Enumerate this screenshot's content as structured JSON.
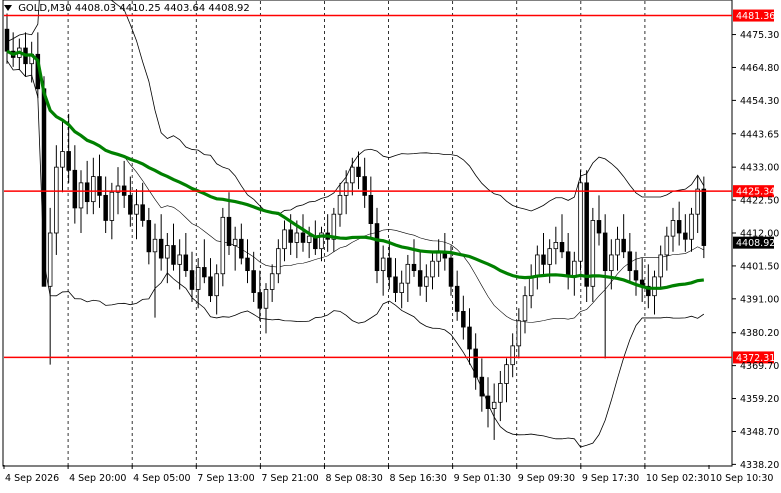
{
  "symbol_info": {
    "symbol": "GOLD,M30",
    "ohlc": "4408.03 4410.25 4403.64 4408.92"
  },
  "colors": {
    "level_line": "#ff0000",
    "ma_line": "#008000",
    "bollinger": "#000000",
    "candle": "#000000",
    "price_tag_text": "#ffffff",
    "current_price_tag": "#000000"
  },
  "chart_data": {
    "type": "candlestick",
    "y_range": [
      4338.0,
      4486.0
    ],
    "y_ticks": [
      "4475.30",
      "4464.80",
      "4454.30",
      "4443.65",
      "4433.00",
      "4422.50",
      "4412.00",
      "4401.50",
      "4391.00",
      "4380.20",
      "4369.70",
      "4359.20",
      "4348.70",
      "4338.20"
    ],
    "x_ticks": [
      "4 Sep 2026",
      "4 Sep 20:00",
      "4 Sep 05:00",
      "7 Sep 13:00",
      "7 Sep 21:00",
      "8 Sep 08:30",
      "8 Sep 16:30",
      "9 Sep 01:30",
      "9 Sep 09:30",
      "9 Sep 17:30",
      "10 Sep 02:30",
      "10 Sep 10:30"
    ],
    "grid": "vertical dashed separators",
    "levels": [
      {
        "label": "4481.36",
        "value": 4481.36
      },
      {
        "label": "4425.34",
        "value": 4425.34
      },
      {
        "label": "4372.31",
        "value": 4372.31
      }
    ],
    "current_price": {
      "label": "4408.92",
      "value": 4408.92
    },
    "ohlc_approx": [
      [
        4477,
        4482,
        4466,
        4470
      ],
      [
        4470,
        4476,
        4465,
        4468
      ],
      [
        4468,
        4474,
        4464,
        4471
      ],
      [
        4471,
        4476,
        4462,
        4466
      ],
      [
        4466,
        4473,
        4460,
        4469
      ],
      [
        4469,
        4476,
        4455,
        4458
      ],
      [
        4458,
        4462,
        4400,
        4395
      ],
      [
        4395,
        4420,
        4370,
        4412
      ],
      [
        4412,
        4440,
        4405,
        4433
      ],
      [
        4433,
        4448,
        4425,
        4438
      ],
      [
        4438,
        4450,
        4428,
        4432
      ],
      [
        4432,
        4440,
        4415,
        4420
      ],
      [
        4420,
        4432,
        4412,
        4428
      ],
      [
        4428,
        4435,
        4418,
        4422
      ],
      [
        4422,
        4436,
        4418,
        4430
      ],
      [
        4430,
        4437,
        4420,
        4424
      ],
      [
        4424,
        4430,
        4412,
        4416
      ],
      [
        4416,
        4428,
        4410,
        4425
      ],
      [
        4425,
        4433,
        4418,
        4427
      ],
      [
        4427,
        4435,
        4420,
        4424
      ],
      [
        4424,
        4430,
        4414,
        4418
      ],
      [
        4418,
        4426,
        4410,
        4421
      ],
      [
        4421,
        4428,
        4414,
        4416
      ],
      [
        4416,
        4420,
        4402,
        4406
      ],
      [
        4406,
        4415,
        4385,
        4410
      ],
      [
        4410,
        4418,
        4400,
        4404
      ],
      [
        4404,
        4412,
        4396,
        4408
      ],
      [
        4408,
        4415,
        4400,
        4402
      ],
      [
        4402,
        4410,
        4394,
        4405
      ],
      [
        4405,
        4412,
        4398,
        4400
      ],
      [
        4400,
        4406,
        4390,
        4394
      ],
      [
        4394,
        4404,
        4388,
        4401
      ],
      [
        4401,
        4410,
        4396,
        4398
      ],
      [
        4398,
        4404,
        4390,
        4392
      ],
      [
        4392,
        4402,
        4386,
        4399
      ],
      [
        4399,
        4420,
        4395,
        4417
      ],
      [
        4417,
        4425,
        4405,
        4408
      ],
      [
        4408,
        4414,
        4400,
        4410
      ],
      [
        4410,
        4415,
        4402,
        4404
      ],
      [
        4404,
        4410,
        4396,
        4400
      ],
      [
        4400,
        4406,
        4390,
        4393
      ],
      [
        4393,
        4400,
        4384,
        4388
      ],
      [
        4388,
        4396,
        4380,
        4394
      ],
      [
        4394,
        4402,
        4390,
        4399
      ],
      [
        4399,
        4410,
        4396,
        4407
      ],
      [
        4407,
        4416,
        4403,
        4413
      ],
      [
        4413,
        4418,
        4405,
        4409
      ],
      [
        4409,
        4416,
        4404,
        4412
      ],
      [
        4412,
        4418,
        4406,
        4409
      ],
      [
        4409,
        4414,
        4404,
        4411
      ],
      [
        4411,
        4416,
        4405,
        4407
      ],
      [
        4407,
        4414,
        4403,
        4412
      ],
      [
        4412,
        4418,
        4406,
        4410
      ],
      [
        4410,
        4420,
        4406,
        4418
      ],
      [
        4418,
        4428,
        4414,
        4424
      ],
      [
        4424,
        4432,
        4418,
        4428
      ],
      [
        4428,
        4436,
        4424,
        4433
      ],
      [
        4433,
        4438,
        4426,
        4430
      ],
      [
        4430,
        4436,
        4420,
        4424
      ],
      [
        4424,
        4430,
        4410,
        4415
      ],
      [
        4415,
        4420,
        4396,
        4400
      ],
      [
        4400,
        4408,
        4392,
        4404
      ],
      [
        4404,
        4410,
        4394,
        4398
      ],
      [
        4398,
        4404,
        4390,
        4393
      ],
      [
        4393,
        4400,
        4388,
        4396
      ],
      [
        4396,
        4405,
        4390,
        4402
      ],
      [
        4402,
        4410,
        4398,
        4400
      ],
      [
        4400,
        4406,
        4392,
        4395
      ],
      [
        4395,
        4402,
        4390,
        4398
      ],
      [
        4398,
        4406,
        4394,
        4403
      ],
      [
        4403,
        4410,
        4398,
        4406
      ],
      [
        4406,
        4412,
        4400,
        4404
      ],
      [
        4404,
        4408,
        4392,
        4395
      ],
      [
        4395,
        4400,
        4384,
        4387
      ],
      [
        4387,
        4392,
        4378,
        4382
      ],
      [
        4382,
        4388,
        4370,
        4375
      ],
      [
        4375,
        4380,
        4362,
        4366
      ],
      [
        4366,
        4372,
        4355,
        4360
      ],
      [
        4360,
        4366,
        4350,
        4356
      ],
      [
        4356,
        4364,
        4346,
        4358
      ],
      [
        4358,
        4368,
        4352,
        4364
      ],
      [
        4364,
        4372,
        4358,
        4370
      ],
      [
        4370,
        4380,
        4366,
        4376
      ],
      [
        4376,
        4388,
        4372,
        4384
      ],
      [
        4384,
        4395,
        4380,
        4392
      ],
      [
        4392,
        4402,
        4388,
        4398
      ],
      [
        4398,
        4408,
        4394,
        4405
      ],
      [
        4405,
        4412,
        4398,
        4402
      ],
      [
        4402,
        4410,
        4396,
        4407
      ],
      [
        4407,
        4414,
        4402,
        4409
      ],
      [
        4409,
        4418,
        4404,
        4406
      ],
      [
        4406,
        4412,
        4394,
        4398
      ],
      [
        4398,
        4406,
        4392,
        4403
      ],
      [
        4403,
        4432,
        4400,
        4428
      ],
      [
        4428,
        4432,
        4390,
        4395
      ],
      [
        4395,
        4420,
        4390,
        4416
      ],
      [
        4416,
        4424,
        4408,
        4412
      ],
      [
        4412,
        4418,
        4372,
        4400
      ],
      [
        4400,
        4410,
        4394,
        4405
      ],
      [
        4405,
        4414,
        4400,
        4410
      ],
      [
        4410,
        4418,
        4404,
        4406
      ],
      [
        4406,
        4412,
        4396,
        4400
      ],
      [
        4400,
        4406,
        4392,
        4397
      ],
      [
        4397,
        4404,
        4390,
        4395
      ],
      [
        4395,
        4402,
        4388,
        4392
      ],
      [
        4392,
        4400,
        4386,
        4398
      ],
      [
        4398,
        4408,
        4394,
        4405
      ],
      [
        4405,
        4414,
        4400,
        4411
      ],
      [
        4411,
        4420,
        4406,
        4416
      ],
      [
        4416,
        4422,
        4408,
        4412
      ],
      [
        4412,
        4418,
        4406,
        4410
      ],
      [
        4410,
        4420,
        4406,
        4418
      ],
      [
        4418,
        4430,
        4412,
        4426
      ],
      [
        4426,
        4430,
        4404,
        4408
      ]
    ]
  }
}
